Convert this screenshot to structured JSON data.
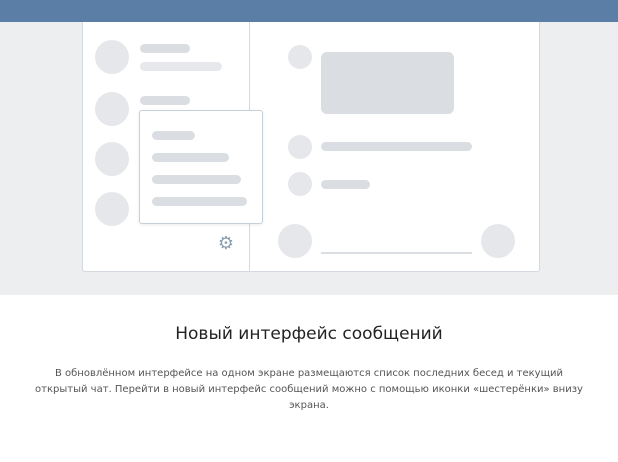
{
  "heading": "Новый интерфейс сообщений",
  "description": "В обновлённом интерфейсе на одном экране размещаются список последних бесед и текущий открытый чат. Перейти в новый интерфейс сообщений можно с помощью иконки «шестерёнки» внизу экрана.",
  "icons": {
    "gear": "gear-icon"
  },
  "colors": {
    "topbar": "#5b7ea6",
    "illustration_bg": "#edeef0",
    "placeholder": "#dadde1",
    "gear": "#8d9fb2"
  }
}
